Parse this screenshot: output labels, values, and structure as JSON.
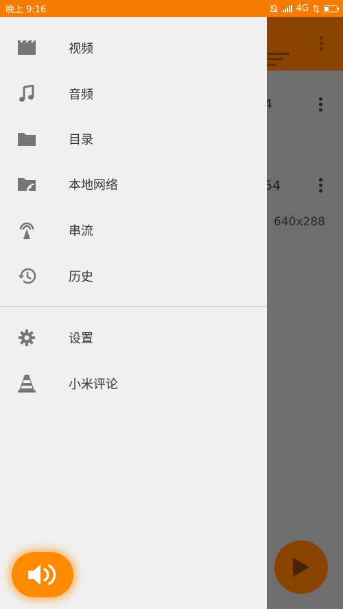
{
  "status_bar": {
    "time": "晚上 9:16",
    "network": "4G"
  },
  "background": {
    "item1_title_fragment": "4",
    "item2_title_fragment": "54",
    "item2_resolution": "640x288"
  },
  "drawer": {
    "items": [
      {
        "label": "视频",
        "icon": "video-clapper-icon"
      },
      {
        "label": "音频",
        "icon": "music-note-icon"
      },
      {
        "label": "目录",
        "icon": "folder-icon"
      },
      {
        "label": "本地网络",
        "icon": "network-folder-icon"
      },
      {
        "label": "串流",
        "icon": "stream-antenna-icon"
      },
      {
        "label": "历史",
        "icon": "history-icon"
      }
    ],
    "secondary": [
      {
        "label": "设置",
        "icon": "gear-icon"
      },
      {
        "label": "小米评论",
        "icon": "vlc-cone-icon"
      }
    ]
  },
  "colors": {
    "accent": "#f57c00",
    "drawer_bg": "#f0f0f0",
    "icon_gray": "#757575"
  }
}
